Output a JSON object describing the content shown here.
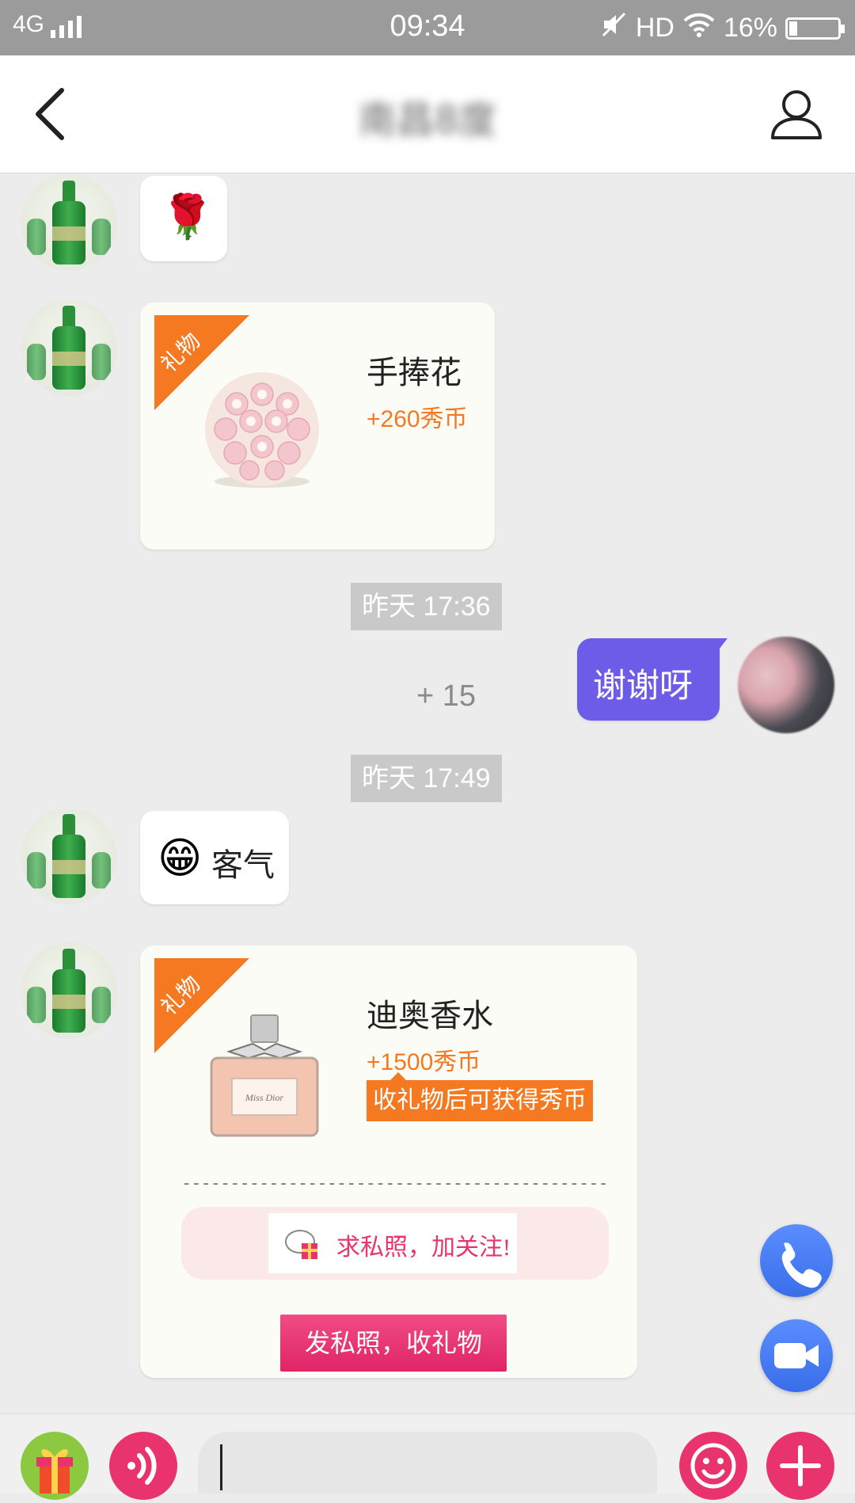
{
  "status_bar": {
    "network": "4G",
    "time": "09:34",
    "hd_label": "HD",
    "battery_percent": "16%",
    "battery_level": 0.16
  },
  "header": {
    "title": "南昌8度"
  },
  "messages": {
    "rose": {
      "emoji": "🌹"
    },
    "gift1": {
      "ribbon": "礼物",
      "name": "手捧花",
      "price": "+260秀币"
    },
    "timestamp1": "昨天 17:36",
    "mine": {
      "text": "谢谢呀",
      "bonus": "+ 15"
    },
    "timestamp2": "昨天 17:49",
    "reply": {
      "emoji": "😁",
      "text": "客气"
    },
    "gift2": {
      "ribbon": "礼物",
      "name": "迪奥香水",
      "price": "+1500秀币",
      "tip": "收礼物后可获得秀币",
      "perfume_label": "Miss Dior",
      "dashes": "------------------------------------------------------------",
      "request_text": "求私照，加关注!",
      "action_button": "发私照，收礼物"
    }
  },
  "icons": {
    "back": "chevron-left-icon",
    "profile": "person-icon",
    "phone": "phone-icon",
    "video": "video-camera-icon",
    "gift": "gift-icon",
    "voice": "voice-icon",
    "emoji": "smiley-icon",
    "add": "plus-icon"
  },
  "colors": {
    "accent_purple": "#6c5ce7",
    "gift_orange": "#f47920",
    "pink_button": "#e8336d",
    "float_blue": "#3a6ee8"
  }
}
